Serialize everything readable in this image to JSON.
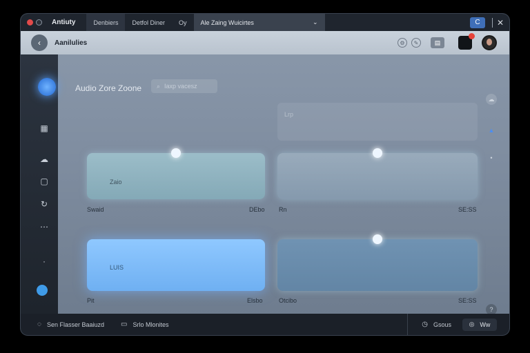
{
  "titlebar": {
    "app_name": "Antiuty",
    "tabs": [
      "Denbiers",
      "Detfol Diner",
      "Oy"
    ],
    "active_tab": "Ale Zaing Wuicirtes",
    "dropdown_glyph": "⌄",
    "window_btn": "C",
    "close_glyph": "✕"
  },
  "header": {
    "back_glyph": "‹",
    "title": "Aanilulies"
  },
  "sidebar": {
    "icons": [
      "grid-icon",
      "cloud-icon",
      "square-icon",
      "refresh-icon",
      "more-icon"
    ]
  },
  "main": {
    "title": "Audio Zore Zoone",
    "search_placeholder": "Iaxp vacesz",
    "ghost_label": "Lrp",
    "cards": [
      {
        "label": "Zaio",
        "caption_left": "Swaid",
        "caption_right": "DEbo",
        "level": 0.5
      },
      {
        "label": "",
        "caption_left": "Rn",
        "caption_right": "SE:SS",
        "level": 0.5
      },
      {
        "label": "LUIS",
        "caption_left": "Pit",
        "caption_right": "Elsbo",
        "level": 0.5
      },
      {
        "label": "",
        "caption_left": "Otcibo",
        "caption_right": "SE:SS",
        "level": 0.5
      }
    ]
  },
  "footer": {
    "left_items": [
      "Sen Flasser Baaiuzd",
      "Srlo Mlonites"
    ],
    "right_item": "Gsous",
    "right_button": "Ww"
  },
  "colors": {
    "accent": "#3f9be8",
    "badge": "#e6433a"
  }
}
